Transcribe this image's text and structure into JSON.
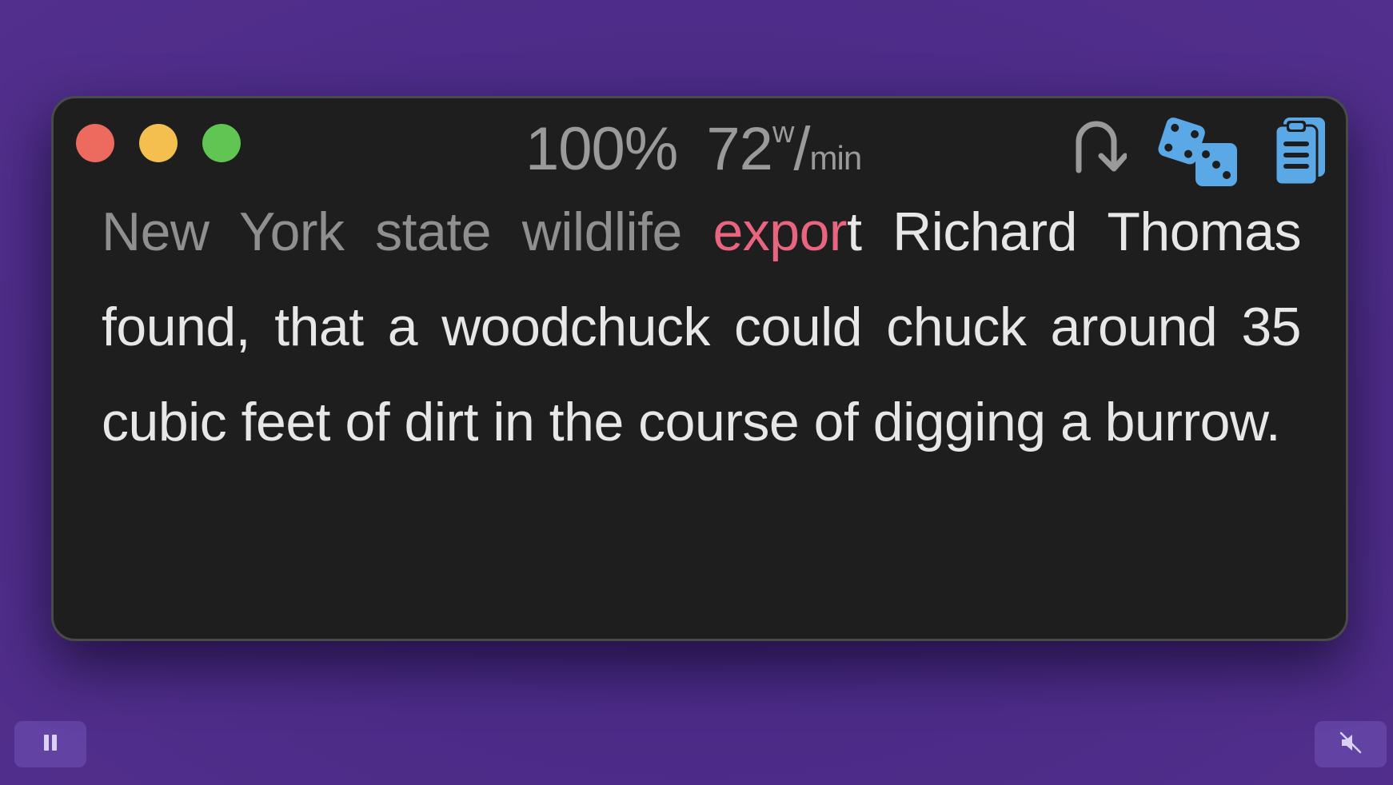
{
  "window": {
    "traffic_lights": [
      "close",
      "minimize",
      "zoom"
    ],
    "colors": {
      "close": "#ed6a5e",
      "minimize": "#f4bf4f",
      "zoom": "#61c554"
    }
  },
  "header": {
    "accuracy": "100%",
    "speed_value": "72",
    "speed_unit_top": "w",
    "speed_unit_slash": "/",
    "speed_unit_bottom": "min"
  },
  "toolbar": {
    "icons": [
      "redo-arrow-icon",
      "dice-icon",
      "clipboard-icon"
    ],
    "accent_color": "#5aa9e6"
  },
  "passage": {
    "read_text": "New York state wildlife ",
    "current_typed": "expor",
    "remaining_text": "t Richard Thomas found, that a woodchuck could chuck around 35 cubic feet of dirt in the course of digging a burrow.",
    "colors": {
      "read": "#8f8f8f",
      "current": "#e9657f",
      "remaining": "#e7e7e7"
    }
  },
  "controls": {
    "pause_icon": "pause-icon",
    "mute_icon": "speaker-muted-icon"
  }
}
